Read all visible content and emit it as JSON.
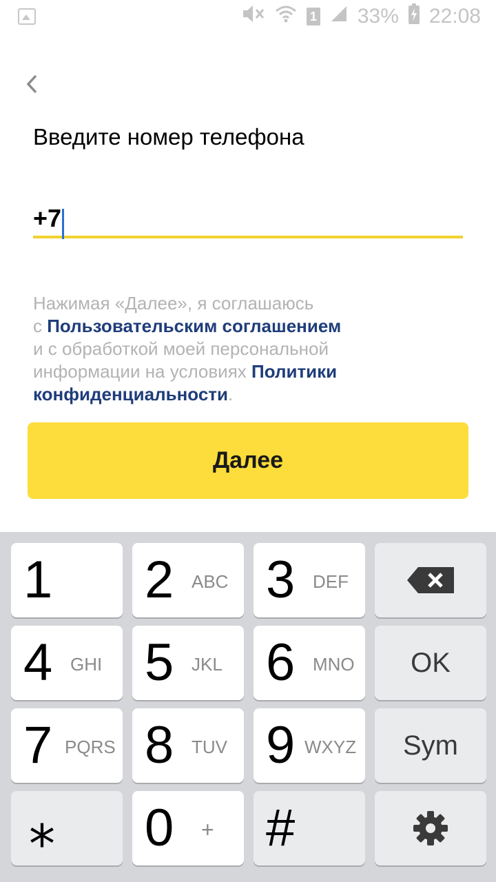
{
  "status_bar": {
    "battery_percent": "33%",
    "time": "22:08",
    "sim_label": "1",
    "icons": [
      "image-icon",
      "mute-icon",
      "wifi-icon",
      "sim-icon",
      "signal-icon",
      "battery-charging-icon"
    ]
  },
  "header": {
    "back_icon": "chevron-left-icon",
    "title": "Введите номер телефона"
  },
  "phone_input": {
    "value": "+7"
  },
  "legal": {
    "part1": "Нажимая «Далее», я соглашаюсь",
    "part2": "с ",
    "link1": "Пользовательским соглашением",
    "part3": "и с обработкой моей персональной",
    "part4": "информации на условиях ",
    "link2_a": "Политики",
    "link2_b": "конфиденциальности",
    "part5": "."
  },
  "next_button": {
    "label": "Далее",
    "color": "#fddd3b"
  },
  "keyboard": {
    "keys": [
      {
        "digit": "1",
        "letters": ""
      },
      {
        "digit": "2",
        "letters": "ABC"
      },
      {
        "digit": "3",
        "letters": "DEF"
      },
      {
        "icon": "backspace-icon"
      },
      {
        "digit": "4",
        "letters": "GHI"
      },
      {
        "digit": "5",
        "letters": "JKL"
      },
      {
        "digit": "6",
        "letters": "MNO"
      },
      {
        "label": "OK"
      },
      {
        "digit": "7",
        "letters": "PQRS"
      },
      {
        "digit": "8",
        "letters": "TUV"
      },
      {
        "digit": "9",
        "letters": "WXYZ"
      },
      {
        "label": "Sym"
      },
      {
        "digit": "⁎",
        "letters": ""
      },
      {
        "digit": "0",
        "letters": "+"
      },
      {
        "digit": "#",
        "letters": ""
      },
      {
        "icon": "gear-icon"
      }
    ]
  }
}
